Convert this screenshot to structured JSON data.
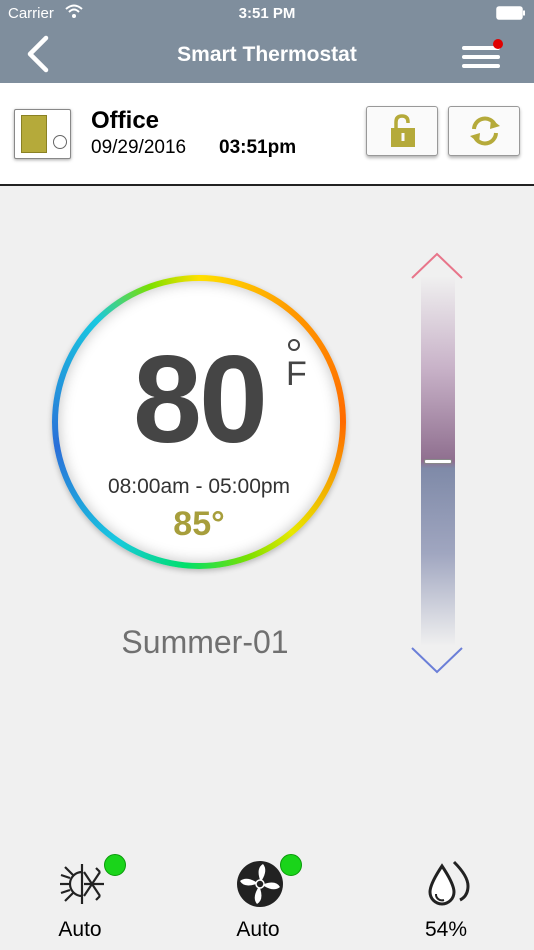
{
  "status_bar": {
    "carrier": "Carrier",
    "time": "3:51 PM"
  },
  "nav": {
    "title": "Smart Thermostat",
    "menu_badge_color": "#e00000"
  },
  "info": {
    "room": "Office",
    "date": "09/29/2016",
    "time": "03:51pm"
  },
  "dial": {
    "temperature": "80",
    "unit": "F",
    "schedule": "08:00am - 05:00pm",
    "setpoint": "85°"
  },
  "profile": "Summer-01",
  "slider": {
    "level": 0.5
  },
  "bottom": {
    "mode": {
      "label": "Auto",
      "active": true
    },
    "fan": {
      "label": "Auto",
      "active": true
    },
    "humidity": {
      "label": "54%"
    }
  },
  "colors": {
    "header": "#7f8e9d",
    "accent": "#b5aa3a",
    "setpoint": "#a79e3c",
    "active_indicator": "#1ad41a"
  }
}
